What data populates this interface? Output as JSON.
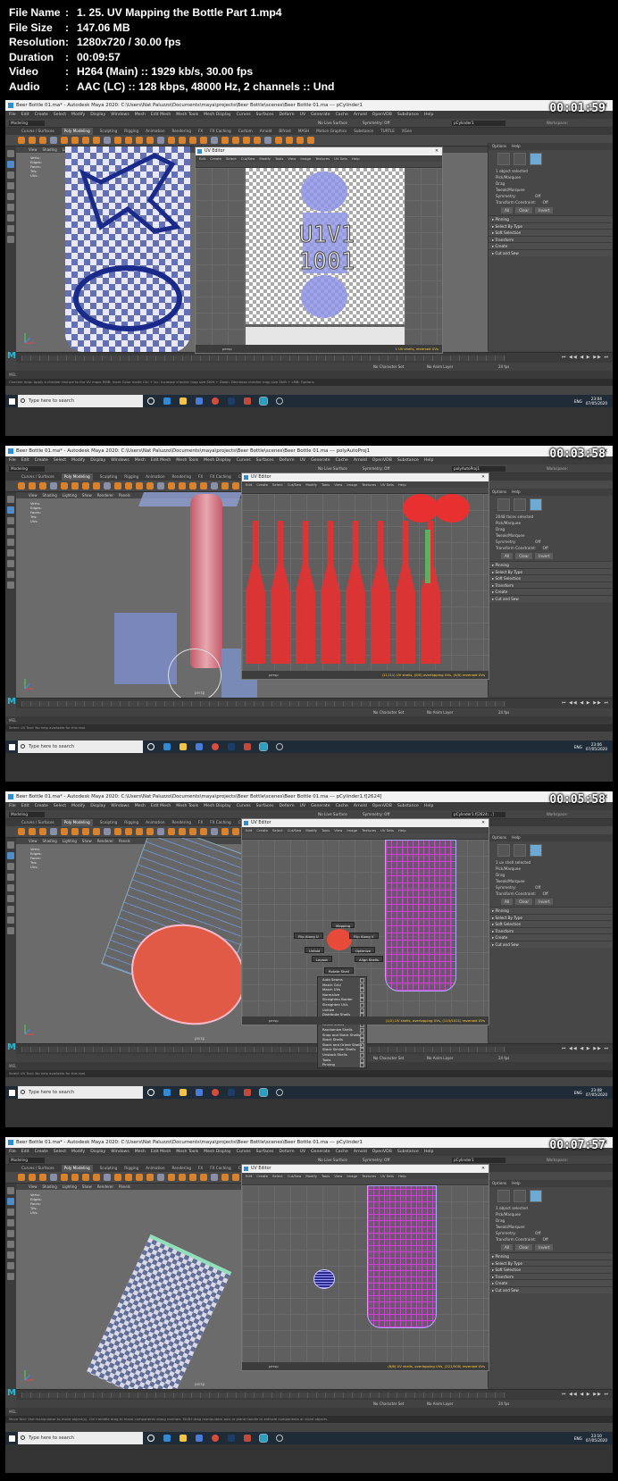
{
  "file_info": [
    {
      "key": "File Name",
      "value": "1. 25. UV Mapping the Bottle Part 1.mp4"
    },
    {
      "key": "File Size",
      "value": "147.06 MB"
    },
    {
      "key": "Resolution",
      "value": "1280x720 / 30.00 fps"
    },
    {
      "key": "Duration",
      "value": "00:09:57"
    },
    {
      "key": "Video",
      "value": "H264 (Main) :: 1929 kb/s, 30.00 fps"
    },
    {
      "key": "Audio",
      "value": "AAC (LC) :: 128 kbps, 48000 Hz, 2 channels :: Und"
    }
  ],
  "colon": ":",
  "common": {
    "menu": [
      "File",
      "Edit",
      "Create",
      "Select",
      "Modify",
      "Display",
      "Windows",
      "Mesh",
      "Edit Mesh",
      "Mesh Tools",
      "Mesh Display",
      "Curves",
      "Surfaces",
      "Deform",
      "UV",
      "Generate",
      "Cache",
      "Arnold",
      "OpenVDB",
      "Substance",
      "Help"
    ],
    "mode": "Modeling",
    "live_surface": "No Live Surface",
    "symmetry": "Symmetry: Off",
    "workspace": "Workspace:",
    "tabs": [
      "Curves / Surfaces",
      "Poly Modeling",
      "Sculpting",
      "Rigging",
      "Animation",
      "Rendering",
      "FX",
      "FX Caching",
      "Custom",
      "Arnold",
      "Bifrost",
      "MASH",
      "Motion Graphics",
      "Substance",
      "TURTLE",
      "XGen"
    ],
    "panel_menu": [
      "View",
      "Shading",
      "Lighting",
      "Show",
      "Renderer",
      "Panels"
    ],
    "hud_labels": [
      "Verts:",
      "Edges:",
      "Faces:",
      "Tris:",
      "UVs:"
    ],
    "uv_title": "UV Editor",
    "uv_menu": [
      "Edit",
      "Create",
      "Select",
      "Cut/Sew",
      "Modify",
      "Tools",
      "View",
      "Image",
      "Textures",
      "UV Sets",
      "Help"
    ],
    "persp": "persp",
    "chan_menu": [
      "Options",
      "Help"
    ],
    "chan_sections": [
      "Pinning",
      "Select By Type",
      "Soft Selection",
      "Transform",
      "Create",
      "Cut and Sew"
    ],
    "chan_modes": [
      "Pick/Marquee",
      "Drag",
      "Tweak/Marquee"
    ],
    "symmetry_row": "Symmetry:",
    "off": "Off",
    "transform_constraint": "Transform Constraint:",
    "buttons": [
      "All",
      "Clear",
      "Invert"
    ],
    "uv_sets": "UV Sets",
    "no_char": "No Character Set",
    "no_anim": "No Anim Layer",
    "fps": "24 fps",
    "mel": "MEL",
    "search": "Type here to search",
    "lang": "ENG",
    "maya_logo": "M",
    "playback": "⏮ ◀◀ ◀ ▶ ▶▶ ⏭"
  },
  "shots": [
    {
      "id": "s1",
      "timestamp": "00:01:59",
      "title": "Beer Bottle 01.ma* - Autodesk Maya 2020: C:\\Users\\Nat Paluzzo\\Documents\\maya\\projects\\Beer Bottle\\scenes\\Beer Bottle 01.ma  ---  pCylinder1",
      "object": "pCylinder1",
      "uv_label": "U1V1\n1001",
      "uv_status": "1 UV shells, reversed UVs",
      "chan_status": "1 object selected",
      "help": "Checker map: Apply a checker texture to the UV maps   RMB: more Color mode  Ctrl + Icc: Increase checker map size  Shift + Down: Decrease checker map size  Shift + LMB: Options",
      "clock": [
        "23:04",
        "07/05/2020"
      ]
    },
    {
      "id": "s2",
      "timestamp": "00:03:58",
      "title": "Beer Bottle 01.ma* - Autodesk Maya 2020: C:\\Users\\Nat Paluzzo\\Documents\\maya\\projects\\Beer Bottle\\scenes\\Beer Bottle 01.ma  ---  polyAutoProj1",
      "object": "polyAutoProj1",
      "uv_status": "(11111) UV shells, (0/0) overlapping UVs, (0/0) reversed UVs",
      "chan_status": "2048 faces selected",
      "help": "Select UV Tool: No help available for this tool.",
      "clock": [
        "23:06",
        "07/05/2020"
      ]
    },
    {
      "id": "s3",
      "timestamp": "00:05:58",
      "title": "Beer Bottle 01.ma* - Autodesk Maya 2020: C:\\Users\\Nat Paluzzo\\Documents\\maya\\projects\\Beer Bottle\\scenes\\Beer Bottle 01.ma  ---  pCylinder1.f[2624]",
      "object": "pCylinder1.f[2624:...]",
      "uv_status": "(1/2) UV shells, overlapping UVs, (115/1021) reversed UVs",
      "chan_status": "1 uv shell selected",
      "help": "Select UV Tool: No help available for this tool.",
      "clock": [
        "23:08",
        "07/05/2020"
      ],
      "marking_top": [
        "Mapping",
        "Flip Along U",
        "Flip Along V",
        "Unfold",
        "Optimize",
        "Layout",
        "Align Shells",
        "Rotate Shell"
      ],
      "marking_list": [
        "Auto Seams",
        "Match Grid",
        "Match UVs",
        "Normalize",
        "Straighten Border",
        "Straighten UVs",
        "Unitize",
        "Distribute Shells",
        "Gather Shells",
        "Orient Shells",
        "Randomize Shells",
        "Snap and Stack Shells",
        "Stack Shells",
        "Stack and Orient Shells",
        "Stack Similar Shells",
        "Unstack Shells",
        "Tools",
        "Pinning"
      ]
    },
    {
      "id": "s4",
      "timestamp": "00:07:57",
      "title": "Beer Bottle 01.ma* - Autodesk Maya 2020: C:\\Users\\Nat Paluzzo\\Documents\\maya\\projects\\Beer Bottle\\scenes\\Beer Bottle 01.ma  ---  pCylinder1",
      "object": "pCylinder1",
      "uv_status": "(6/6) UV shells, overlapping UVs, (221/500) reversed UVs",
      "chan_status": "1 object selected",
      "help": "Move Tool: Use manipulator to move object(s). Ctrl+middle drag to move components along normals. Shift+drag manipulator axis or plane handle to extrude components or clone objects.",
      "clock": [
        "23:10",
        "07/05/2020"
      ]
    }
  ],
  "colors": {
    "accent": "#d9822b",
    "uv_blue": "#8f95e8",
    "uv_red": "#e83030",
    "uv_magenta": "#d23ed8",
    "checker_a": "#e8e8f6",
    "checker_b": "#6470b4"
  }
}
